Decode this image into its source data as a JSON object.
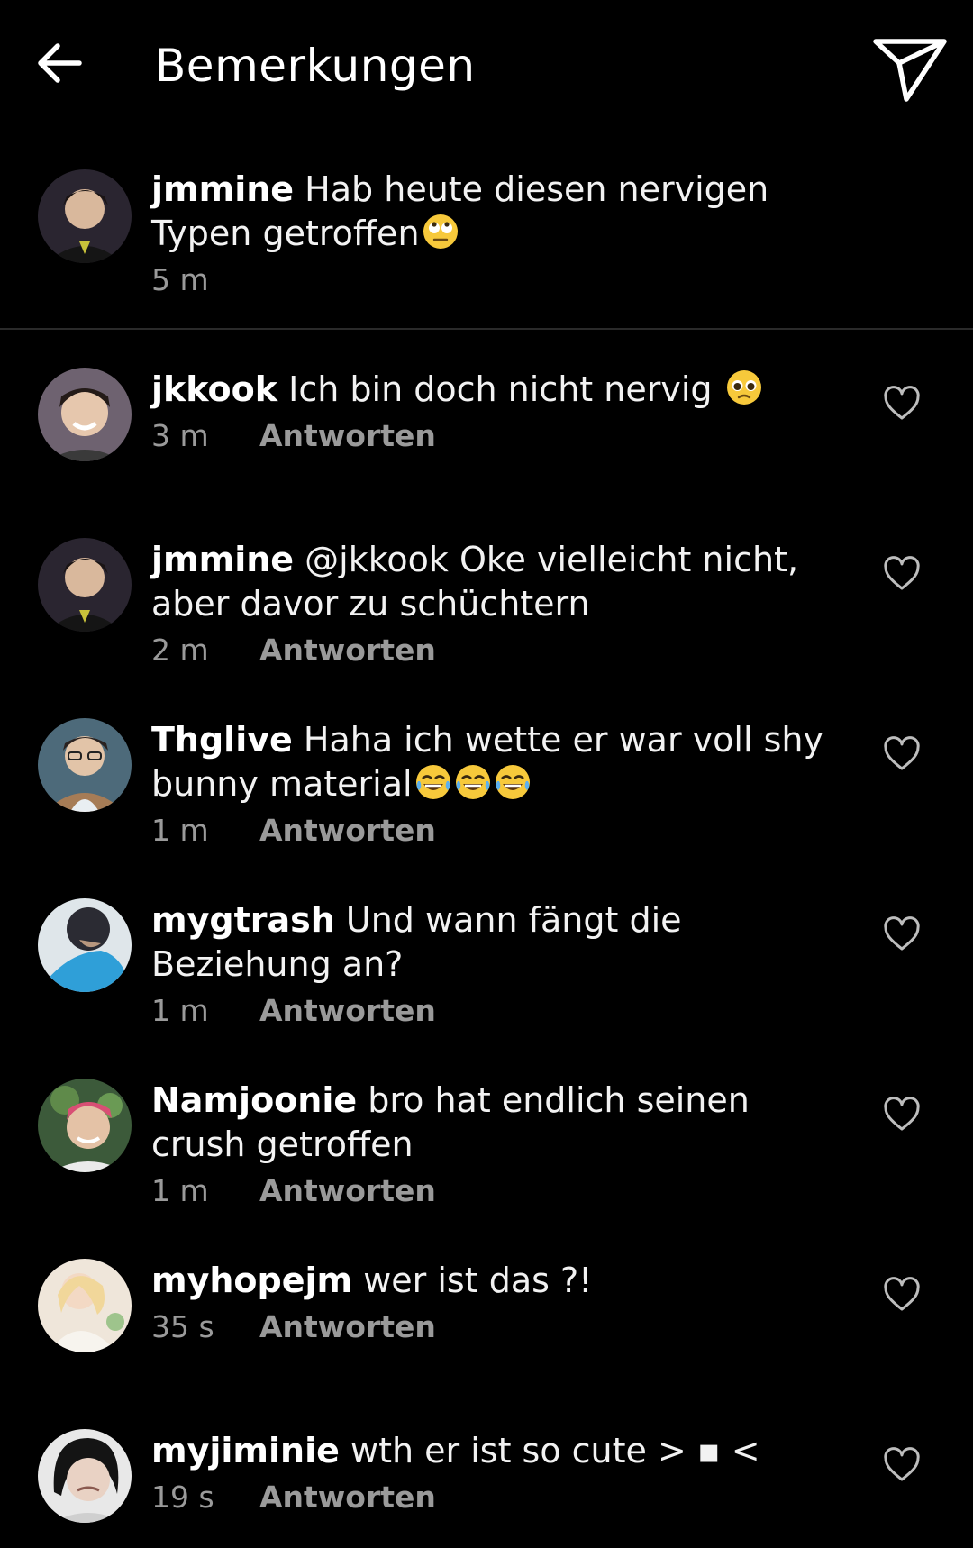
{
  "header": {
    "back_icon": "arrow-left-icon",
    "title": "Bemerkungen",
    "send_icon": "paper-plane-icon"
  },
  "caption": {
    "username": "jmmine",
    "text": "Hab heute diesen nervigen Typen getroffen",
    "emoji": "🙄",
    "time": "5 m"
  },
  "comments": [
    {
      "username": "jkkook",
      "text": "Ich bin doch nicht nervig ",
      "emoji": "🥺",
      "time": "3 m",
      "reply": "Antworten"
    },
    {
      "username": "jmmine",
      "text": "@jkkook Oke vielleicht nicht, aber davor zu schüchtern",
      "time": "2 m",
      "reply": "Antworten"
    },
    {
      "username": "Thglive",
      "text": "Haha ich wette er war voll shy bunny material",
      "emoji": "😂😂😂",
      "time": "1 m",
      "reply": "Antworten"
    },
    {
      "username": "mygtrash",
      "text": "Und wann fängt die Beziehung an?",
      "time": "1 m",
      "reply": "Antworten"
    },
    {
      "username": "Namjoonie",
      "text": "bro hat endlich seinen crush getroffen",
      "time": "1 m",
      "reply": "Antworten"
    },
    {
      "username": "myhopejm",
      "text": "wer ist das ?!",
      "time": "35 s",
      "reply": "Antworten"
    },
    {
      "username": "myjiminie",
      "text": "wth er ist so cute > ▪ <",
      "time": "19 s",
      "reply": "Antworten"
    }
  ],
  "colors": {
    "background": "#000000",
    "text": "#f2f2f2",
    "meta": "#9a9a9a",
    "divider": "#2a2a2a"
  }
}
